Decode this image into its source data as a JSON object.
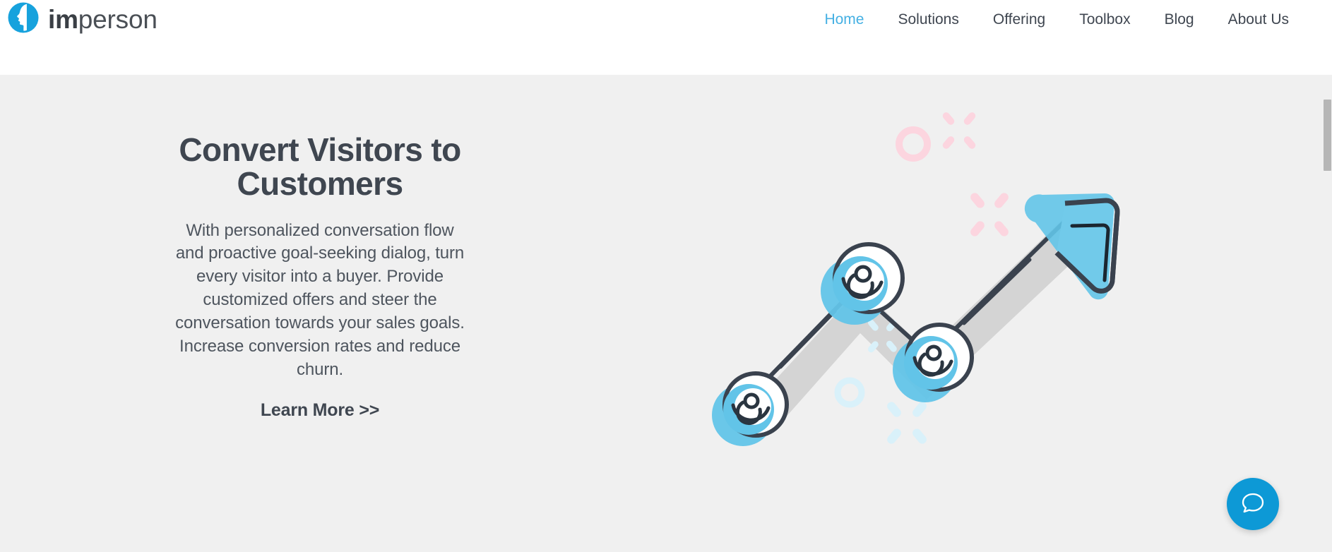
{
  "site": {
    "brand": {
      "logo_icon": "person-profile-circle-icon",
      "name_bold": "im",
      "name_light": "person",
      "accent_color": "#17a2dd"
    },
    "nav": {
      "items": [
        {
          "label": "Home",
          "active": true
        },
        {
          "label": "Solutions",
          "active": false
        },
        {
          "label": "Offering",
          "active": false
        },
        {
          "label": "Toolbox",
          "active": false
        },
        {
          "label": "Blog",
          "active": false
        },
        {
          "label": "About Us",
          "active": false
        }
      ]
    }
  },
  "hero": {
    "title": "Convert Visitors to Customers",
    "body": "With personalized conversation flow and proactive goal-seeking dialog, turn every visitor into a buyer. Provide customized offers and steer the conversation towards your sales goals. Increase conversion rates and reduce churn.",
    "cta_label": "Learn More >>",
    "background_color": "#f0f0f0",
    "illustration": {
      "name": "growth-chart-arrow-illustration",
      "description": "Upward zigzag line chart with three circular chat-swirl nodes and a rounded arrowhead",
      "node_fill": "#62c4e8",
      "outline_color": "#3a424e",
      "shadow_color": "#cccccc",
      "sparkle_pink": "#fcd5df",
      "sparkle_blue": "#d9f1fa"
    }
  },
  "chat_widget": {
    "icon": "chat-bubble-icon",
    "background_color": "#0d99d6",
    "icon_color": "#ffffff"
  },
  "scrollbar": {
    "thumb_color": "#b6b6b6",
    "track_color": "#f0f0f0"
  }
}
